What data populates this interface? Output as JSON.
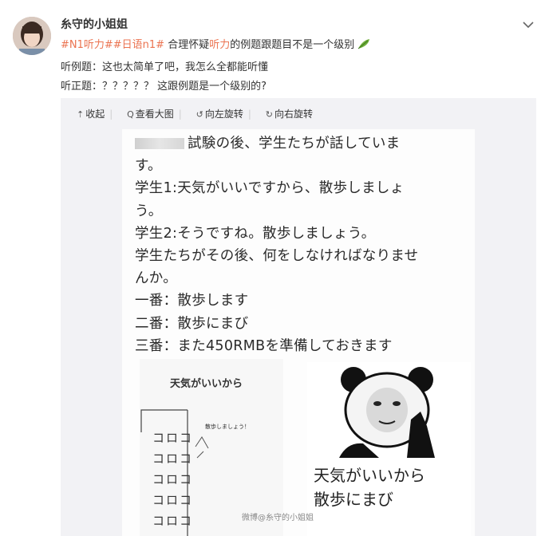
{
  "post": {
    "username": "糸守的小姐姐",
    "tag1": "#N1听力#",
    "tag2": "#日语n1#",
    "text_before": " 合理怀疑",
    "text_highlight": "听力",
    "text_after": "的例题跟题目不是一个级别",
    "line2": "听例题：这也太简单了吧，我怎么全都能听懂",
    "line3": "听正题：？？？？？ 这跟例题是一个级别的?"
  },
  "toolbar": {
    "collapse": "收起",
    "view_large": "查看大图",
    "rotate_left": "向左旋转",
    "rotate_right": "向右旋转"
  },
  "image": {
    "l1": "試験の後、学生たちが話していま",
    "l2": "す。",
    "l3": "学生1:天気がいいですから、散歩しましょ",
    "l4": "う。",
    "l5": "学生2:そうですね。散歩しましょう。",
    "l6": "学生たちがその後、何をしなければなりませ",
    "l7": "んか。",
    "l8": "一番：散歩します",
    "l9": "二番：散歩にまび",
    "l10": "三番：また450RMBを準備しておきます",
    "sub_title": "天気がいいから",
    "sub_small": "散歩しましょう！",
    "sub_boxes": "コロコ",
    "meme_l1": "天気がいいから",
    "meme_l2": "散歩にまび",
    "watermark": "微博@糸守的小姐姐"
  }
}
